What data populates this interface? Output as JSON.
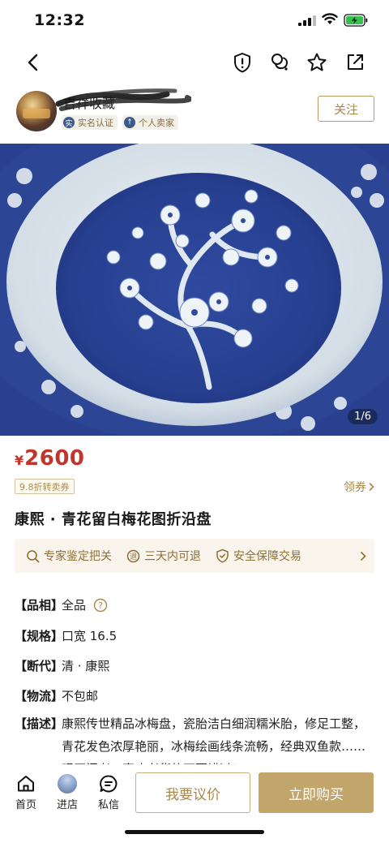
{
  "status_bar": {
    "time": "12:32"
  },
  "seller": {
    "name": "吉祥收藏",
    "badges": [
      {
        "icon_text": "实",
        "label": "实名认证"
      },
      {
        "icon_text": "↑",
        "label": "个人卖家"
      }
    ],
    "follow_label": "关注"
  },
  "gallery": {
    "counter": "1/6"
  },
  "product": {
    "currency": "¥",
    "price": "2600",
    "discount_tag": "9.8折转卖券",
    "coupon_link": "领券",
    "title": "康熙 · 青花留白梅花图折沿盘"
  },
  "services": [
    {
      "icon": "search-icon",
      "label": "专家鉴定把关"
    },
    {
      "icon": "return-icon",
      "label": "三天内可退"
    },
    {
      "icon": "shield-check-icon",
      "label": "安全保障交易"
    }
  ],
  "specs": [
    {
      "key": "【品相】",
      "value": "全品"
    },
    {
      "key": "【规格】",
      "value": "口宽 16.5"
    },
    {
      "key": "【断代】",
      "value": "清 · 康熙"
    },
    {
      "key": "【物流】",
      "value": "不包邮"
    }
  ],
  "description": {
    "key": "【描述】",
    "value": "康熙传世精品冰梅盘，瓷胎洁白细润糯米胎，修足工整，青花发色浓厚艳丽，冰梅绘画线条流畅，经典双鱼款……眼开门老，喜欢老货的不要错过！"
  },
  "bottom_bar": {
    "tabs": [
      {
        "icon": "home-icon",
        "label": "首页"
      },
      {
        "icon": "store-avatar",
        "label": "进店"
      },
      {
        "icon": "chat-icon",
        "label": "私信"
      }
    ],
    "offer_label": "我要议价",
    "buy_label": "立即购买"
  },
  "colors": {
    "accent_gold": "#a8884a",
    "price_red": "#c2352c",
    "buy_button": "#c1a56a"
  }
}
